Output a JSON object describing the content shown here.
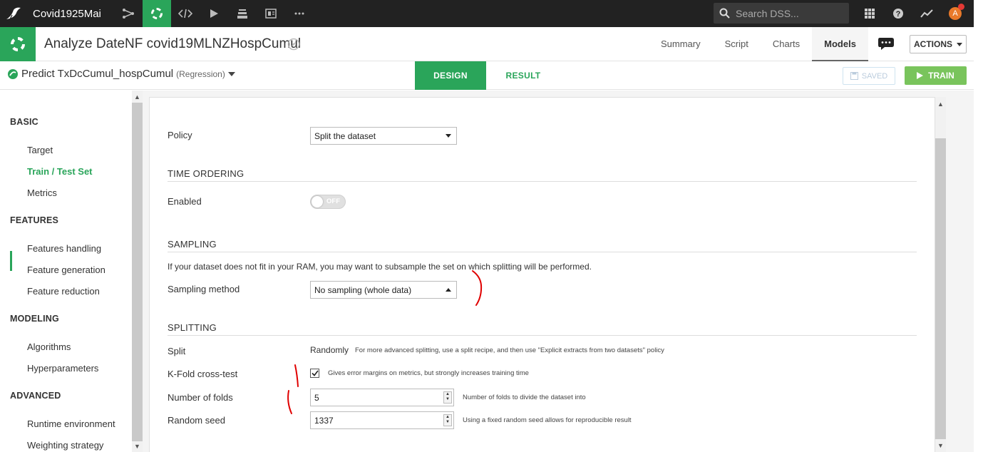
{
  "topbar": {
    "project_name": "Covid1925Mai",
    "search_placeholder": "Search DSS...",
    "avatar_letter": "A"
  },
  "header": {
    "title": "Analyze DateNF covid19MLNZHospCumul",
    "tabs": [
      "Summary",
      "Script",
      "Charts",
      "Models"
    ],
    "active_tab": "Models",
    "actions_label": "ACTIONS"
  },
  "subheader": {
    "predict_label": "Predict TxDcCumul_hospCumul",
    "predict_type": "(Regression)",
    "design_tab": "DESIGN",
    "result_tab": "RESULT",
    "saved_label": "SAVED",
    "train_label": "TRAIN"
  },
  "sidebar": {
    "sections": [
      {
        "title": "BASIC",
        "items": [
          "Target",
          "Train / Test Set",
          "Metrics"
        ]
      },
      {
        "title": "FEATURES",
        "items": [
          "Features handling",
          "Feature generation",
          "Feature reduction"
        ]
      },
      {
        "title": "MODELING",
        "items": [
          "Algorithms",
          "Hyperparameters"
        ]
      },
      {
        "title": "ADVANCED",
        "items": [
          "Runtime environment",
          "Weighting strategy"
        ]
      }
    ],
    "active_item": "Train / Test Set"
  },
  "form": {
    "policy_label": "Policy",
    "policy_value": "Split the dataset",
    "time_ordering_heading": "TIME ORDERING",
    "enabled_label": "Enabled",
    "toggle_text": "OFF",
    "sampling_heading": "SAMPLING",
    "sampling_info": "If your dataset does not fit in your RAM, you may want to subsample the set on which splitting will be performed.",
    "sampling_method_label": "Sampling method",
    "sampling_method_value": "No sampling (whole data)",
    "splitting_heading": "SPLITTING",
    "split_label": "Split",
    "split_value": "Randomly",
    "split_note": "For more advanced splitting, use a split recipe, and then use \"Explicit extracts from two datasets\" policy",
    "kfold_label": "K-Fold cross-test",
    "kfold_checked": true,
    "kfold_note": "Gives error margins on metrics, but strongly increases training time",
    "folds_label": "Number of folds",
    "folds_value": "5",
    "folds_note": "Number of folds to divide the dataset into",
    "seed_label": "Random seed",
    "seed_value": "1337",
    "seed_note": "Using a fixed random seed allows for reproducible result"
  },
  "colors": {
    "accent": "#2aa55a",
    "train_button": "#79c45c",
    "topbar": "#222222",
    "annotation": "#e00000"
  }
}
